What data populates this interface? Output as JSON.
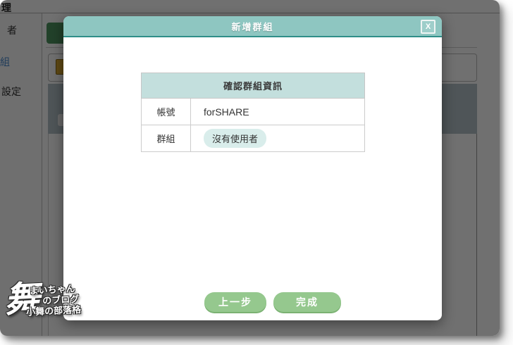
{
  "background": {
    "page_title": "理",
    "sidebar": {
      "items": [
        {
          "label": "者",
          "active": false
        },
        {
          "label": "組",
          "active": true
        },
        {
          "label": "設定",
          "active": false
        }
      ]
    }
  },
  "modal": {
    "title": "新增群組",
    "close_label": "X",
    "table": {
      "header": "確認群組資訊",
      "rows": [
        {
          "label": "帳號",
          "value": "forSHARE",
          "type": "text"
        },
        {
          "label": "群組",
          "value": "沒有使用者",
          "type": "badge"
        }
      ]
    },
    "buttons": {
      "back": "上一步",
      "finish": "完成"
    }
  },
  "watermark": {
    "glyph": "舞",
    "line1": "まいちゃん",
    "line2": "のブログ",
    "line3": "小舞の部落格"
  },
  "colors": {
    "modal_header": "#8ec6c1",
    "modal_header_border": "#2f8e89",
    "table_header_bg": "#c3dfdd",
    "badge_bg": "#d9edeb",
    "button_green": "#95c88e",
    "button_shadow": "#7bb273",
    "overlay": "rgba(0,0,0,0.56)",
    "sidebar_active_text": "#4d8bd0"
  }
}
